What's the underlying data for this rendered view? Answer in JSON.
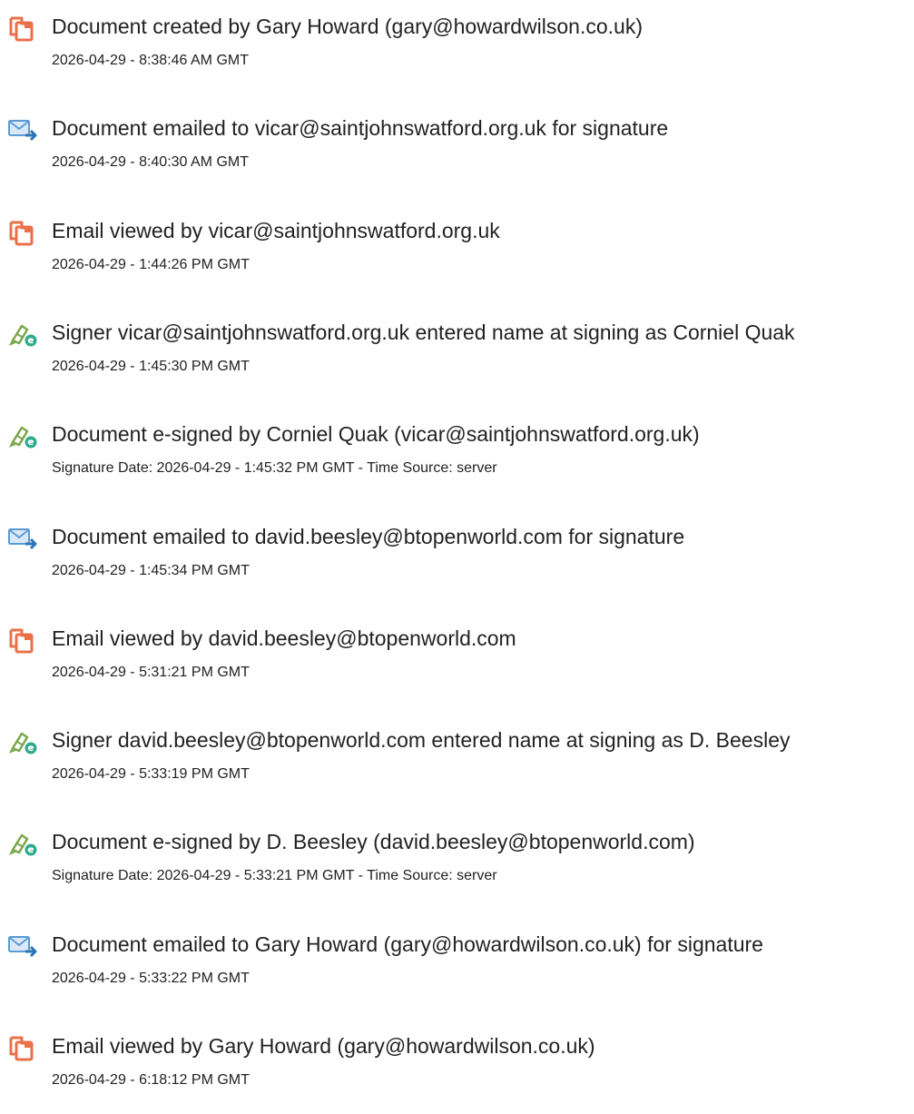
{
  "events": [
    {
      "icon": "document-icon",
      "title": "Document created by Gary Howard (gary@howardwilson.co.uk)",
      "sub": "2026-04-29 - 8:38:46 AM GMT"
    },
    {
      "icon": "email-send-icon",
      "title": "Document emailed to vicar@saintjohnswatford.org.uk for signature",
      "sub": "2026-04-29 - 8:40:30 AM GMT"
    },
    {
      "icon": "document-icon",
      "title": "Email viewed by vicar@saintjohnswatford.org.uk",
      "sub": "2026-04-29 - 1:44:26 PM GMT"
    },
    {
      "icon": "pen-sign-icon",
      "title": "Signer vicar@saintjohnswatford.org.uk entered name at signing as Corniel Quak",
      "sub": "2026-04-29 - 1:45:30 PM GMT"
    },
    {
      "icon": "pen-sign-icon",
      "title": "Document e-signed by Corniel Quak (vicar@saintjohnswatford.org.uk)",
      "sub": "Signature Date: 2026-04-29 - 1:45:32 PM GMT - Time Source: server"
    },
    {
      "icon": "email-send-icon",
      "title": "Document emailed to david.beesley@btopenworld.com for signature",
      "sub": "2026-04-29 - 1:45:34 PM GMT"
    },
    {
      "icon": "document-icon",
      "title": "Email viewed by david.beesley@btopenworld.com",
      "sub": "2026-04-29 - 5:31:21 PM GMT"
    },
    {
      "icon": "pen-sign-icon",
      "title": "Signer david.beesley@btopenworld.com entered name at signing as D. Beesley",
      "sub": "2026-04-29 - 5:33:19 PM GMT"
    },
    {
      "icon": "pen-sign-icon",
      "title": "Document e-signed by D. Beesley (david.beesley@btopenworld.com)",
      "sub": "Signature Date: 2026-04-29 - 5:33:21 PM GMT - Time Source: server"
    },
    {
      "icon": "email-send-icon",
      "title": "Document emailed to Gary Howard (gary@howardwilson.co.uk) for signature",
      "sub": "2026-04-29 - 5:33:22 PM GMT"
    },
    {
      "icon": "document-icon",
      "title": "Email viewed by Gary Howard (gary@howardwilson.co.uk)",
      "sub": "2026-04-29 - 6:18:12 PM GMT"
    }
  ],
  "colors": {
    "document_icon": "#e8714a",
    "email_icon": "#5b9bd5",
    "email_arrow": "#2e75b6",
    "pen_icon": "#7aa84a",
    "sign_badge": "#2eaa8c",
    "text": "#222222"
  }
}
